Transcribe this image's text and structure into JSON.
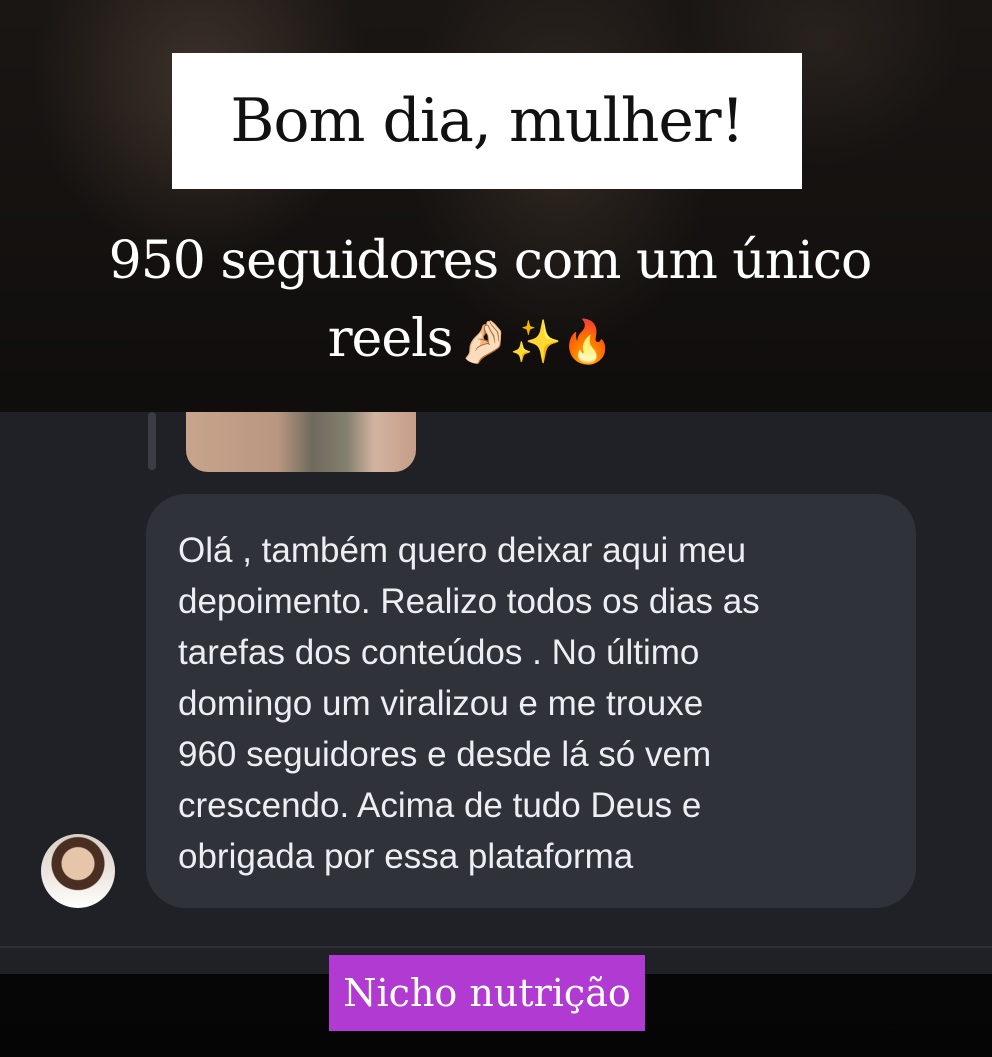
{
  "title": "Bom dia, mulher!",
  "subtitle": {
    "line1": "950 seguidores com um único",
    "line2": "reels",
    "emojis": "🤌🏻✨🔥"
  },
  "message": {
    "text": "Olá , também quero deixar aqui meu\ndepoimento. Realizo todos os dias as\ntarefas dos conteúdos . No último\ndomingo um viralizou e me trouxe\n960 seguidores e desde lá só vem\ncrescendo. Acima de tudo Deus e\nobrigada por essa plataforma"
  },
  "tag": {
    "label": "Nicho nutrição",
    "color": "#b03ad2"
  },
  "colors": {
    "chat_background": "#1f2127",
    "bubble": "#30323a"
  }
}
